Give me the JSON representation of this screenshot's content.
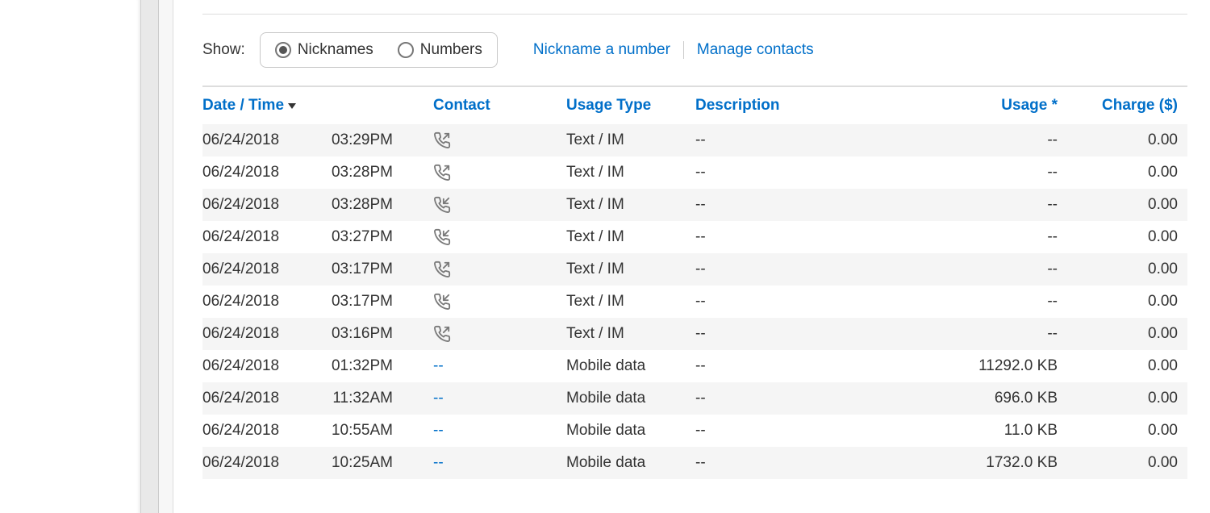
{
  "controls": {
    "show_label": "Show:",
    "radio": {
      "nicknames": "Nicknames",
      "numbers": "Numbers",
      "selected": "nicknames"
    },
    "link_nickname": "Nickname a number",
    "link_manage": "Manage contacts"
  },
  "headers": {
    "date_time": "Date / Time",
    "contact": "Contact",
    "usage_type": "Usage Type",
    "description": "Description",
    "usage_star": "Usage *",
    "charge": "Charge ($)"
  },
  "rows": [
    {
      "date": "06/24/2018",
      "time": "03:29PM",
      "contact_type": "out",
      "usage_type": "Text / IM",
      "description": "--",
      "usage": "--",
      "charge": "0.00"
    },
    {
      "date": "06/24/2018",
      "time": "03:28PM",
      "contact_type": "out",
      "usage_type": "Text / IM",
      "description": "--",
      "usage": "--",
      "charge": "0.00"
    },
    {
      "date": "06/24/2018",
      "time": "03:28PM",
      "contact_type": "in",
      "usage_type": "Text / IM",
      "description": "--",
      "usage": "--",
      "charge": "0.00"
    },
    {
      "date": "06/24/2018",
      "time": "03:27PM",
      "contact_type": "in",
      "usage_type": "Text / IM",
      "description": "--",
      "usage": "--",
      "charge": "0.00"
    },
    {
      "date": "06/24/2018",
      "time": "03:17PM",
      "contact_type": "out",
      "usage_type": "Text / IM",
      "description": "--",
      "usage": "--",
      "charge": "0.00"
    },
    {
      "date": "06/24/2018",
      "time": "03:17PM",
      "contact_type": "in",
      "usage_type": "Text / IM",
      "description": "--",
      "usage": "--",
      "charge": "0.00"
    },
    {
      "date": "06/24/2018",
      "time": "03:16PM",
      "contact_type": "out",
      "usage_type": "Text / IM",
      "description": "--",
      "usage": "--",
      "charge": "0.00"
    },
    {
      "date": "06/24/2018",
      "time": "01:32PM",
      "contact_type": "dash",
      "usage_type": "Mobile data",
      "description": "--",
      "usage": "11292.0 KB",
      "charge": "0.00"
    },
    {
      "date": "06/24/2018",
      "time": "11:32AM",
      "contact_type": "dash",
      "usage_type": "Mobile data",
      "description": "--",
      "usage": "696.0 KB",
      "charge": "0.00"
    },
    {
      "date": "06/24/2018",
      "time": "10:55AM",
      "contact_type": "dash",
      "usage_type": "Mobile data",
      "description": "--",
      "usage": "11.0 KB",
      "charge": "0.00"
    },
    {
      "date": "06/24/2018",
      "time": "10:25AM",
      "contact_type": "dash",
      "usage_type": "Mobile data",
      "description": "--",
      "usage": "1732.0 KB",
      "charge": "0.00"
    }
  ]
}
